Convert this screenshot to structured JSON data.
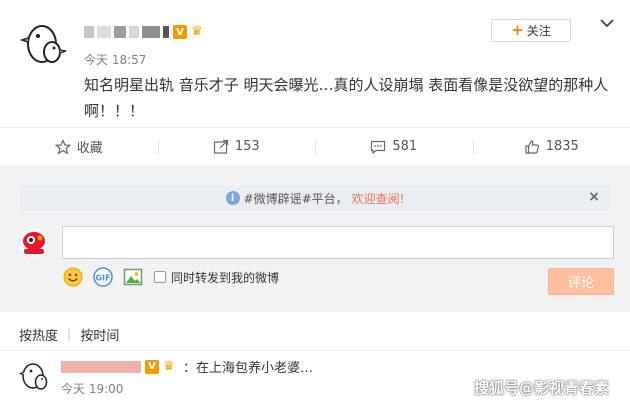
{
  "post": {
    "time": "今天 18:57",
    "content": "知名明星出轨 音乐才子 明天会曝光…真的人设崩塌 表面看像是没欲望的那种人啊！！！",
    "follow_label": "关注",
    "badge_v": "V"
  },
  "actions": {
    "favorite_label": "收藏",
    "repost_count": "153",
    "comment_count": "581",
    "like_count": "1835"
  },
  "notice": {
    "text": "#微博辟谣#平台，",
    "link": "欢迎查阅!",
    "close": "×"
  },
  "composer": {
    "input_value": "",
    "repost_label": "同时转发到我的微博",
    "submit_label": "评论"
  },
  "sort": {
    "hot": "按热度",
    "time": "按时间"
  },
  "comment": {
    "text": "：在上海包养小老婆…",
    "time": "今天 19:00",
    "badge_v": "V"
  },
  "watermark": "搜狐号@影视青春素",
  "colors": {
    "accent": "#ff8200",
    "link": "#eb7350",
    "submit_bg": "#ffc09f"
  }
}
